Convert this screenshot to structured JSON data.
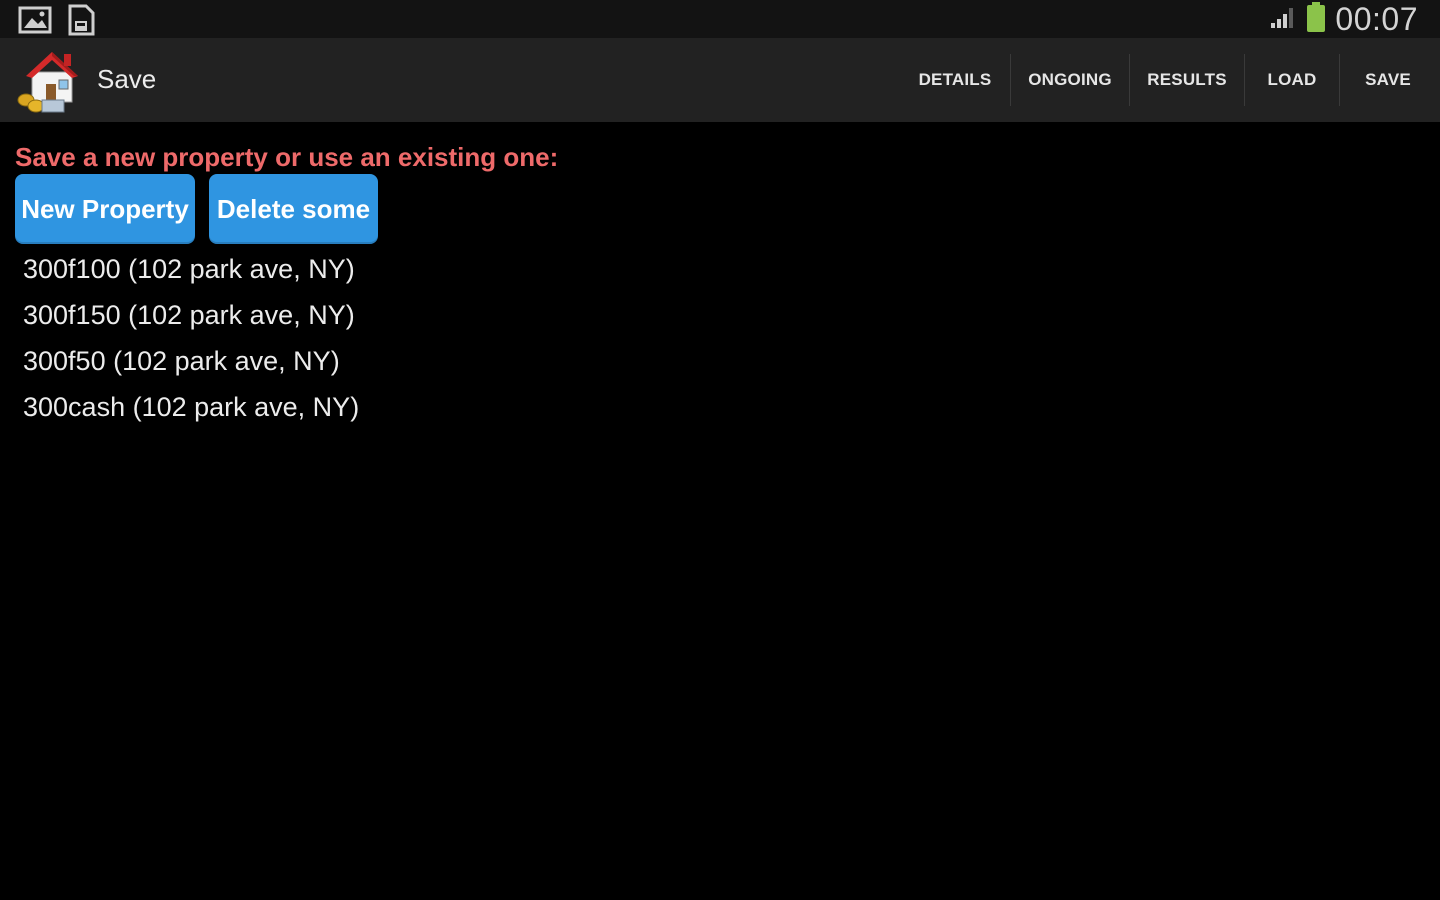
{
  "status_bar": {
    "left_icons": [
      "image-notification-icon",
      "sd-card-icon"
    ],
    "right_icons": [
      "signal-icon",
      "battery-icon"
    ],
    "clock": "00:07",
    "battery_color": "#8bc34a"
  },
  "action_bar": {
    "title": "Save",
    "logo_icon": "house-money-icon",
    "tabs": [
      {
        "label": "DETAILS"
      },
      {
        "label": "ONGOING"
      },
      {
        "label": "RESULTS"
      },
      {
        "label": "LOAD"
      },
      {
        "label": "SAVE"
      }
    ]
  },
  "content": {
    "prompt": "Save a new property or use an existing one:",
    "prompt_color": "#ee6a6a",
    "buttons": {
      "new_property": "New Property",
      "delete_some": "Delete some"
    },
    "button_color": "#2f95e1",
    "properties": [
      {
        "label": "300f100 (102 park ave, NY)"
      },
      {
        "label": "300f150 (102 park ave, NY)"
      },
      {
        "label": "300f50 (102 park ave, NY)"
      },
      {
        "label": "300cash (102 park ave, NY)"
      }
    ]
  }
}
